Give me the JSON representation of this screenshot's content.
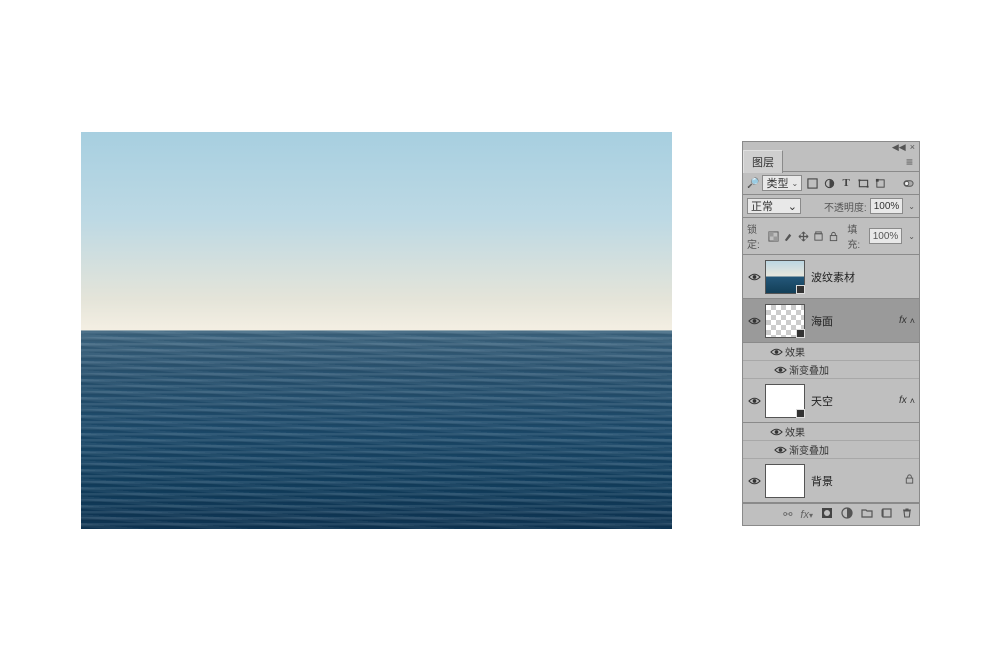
{
  "panel": {
    "title": "图层",
    "filter": {
      "mode": "类型"
    },
    "blend": {
      "mode": "正常",
      "opacity_label": "不透明度:",
      "opacity_value": "100%"
    },
    "lock": {
      "label": "锁定:",
      "fill_label": "填充:",
      "fill_value": "100%"
    },
    "fx_label": "fx",
    "layers": [
      {
        "name": "波纹素材",
        "visible": true,
        "selected": false,
        "thumb": "ocean",
        "has_fx": false,
        "locked": false
      },
      {
        "name": "海面",
        "visible": true,
        "selected": true,
        "thumb": "checker",
        "has_fx": true,
        "locked": false,
        "effects_label": "效果",
        "effects": [
          "渐变叠加"
        ]
      },
      {
        "name": "天空",
        "visible": true,
        "selected": false,
        "thumb": "white",
        "has_fx": true,
        "locked": false,
        "effects_label": "效果",
        "effects": [
          "渐变叠加"
        ]
      },
      {
        "name": "背景",
        "visible": true,
        "selected": false,
        "thumb": "white",
        "has_fx": false,
        "locked": true
      }
    ]
  }
}
